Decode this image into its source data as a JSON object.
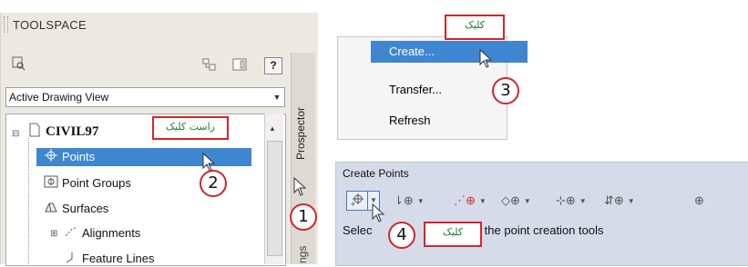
{
  "toolspace": {
    "title": "TOOLSPACE",
    "help_label": "?",
    "view_select": "Active Drawing View",
    "vertical_tab": "Prospector",
    "vertical_tab_lower": "ngs",
    "tree": [
      {
        "label": "CIVIL97",
        "bold": true
      },
      {
        "label": "Points",
        "selected": true
      },
      {
        "label": "Point Groups"
      },
      {
        "label": "Surfaces"
      },
      {
        "label": "Alignments"
      },
      {
        "label": "Feature Lines"
      }
    ]
  },
  "context_menu": {
    "items": [
      "Create...",
      "Transfer...",
      "Refresh"
    ]
  },
  "create_points": {
    "title": "Create Points",
    "status_left": "Selec",
    "status_right": "om the point creation tools"
  },
  "callouts": {
    "badges": [
      "1",
      "2",
      "3",
      "4"
    ],
    "tags": [
      "راست کلیک",
      "کلیک",
      "کلیک"
    ]
  },
  "colors": {
    "accent_red": "#d1262b",
    "tag_text_green": "#1b7d2b",
    "selection_blue": "#3f86d1",
    "toolbar_bg": "#d6dbe9"
  }
}
